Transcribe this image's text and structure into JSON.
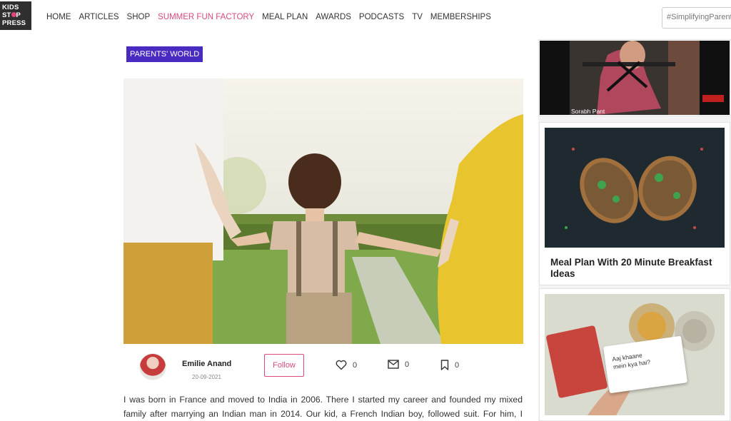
{
  "logo": {
    "line1": "KIDS",
    "line2a": "ST",
    "line2b": "P",
    "line3": "PRESS"
  },
  "nav": [
    "HOME",
    "ARTICLES",
    "SHOP",
    "SUMMER FUN FACTORY",
    "MEAL PLAN",
    "AWARDS",
    "PODCASTS",
    "TV",
    "MEMBERSHIPS"
  ],
  "nav_active_index": 3,
  "search": {
    "value": "#SimplifyingParenting"
  },
  "article": {
    "category": "PARENTS' WORLD",
    "author": "Emilie Anand",
    "date": "20-09-2021",
    "follow_label": "Follow",
    "likes": "0",
    "comments": "0",
    "bookmarks": "0",
    "body": "I was born in France and moved to India in 2006. There I started my career and founded my mixed family after marrying an Indian man in 2014. Our kid, a French Indian boy, followed suit. For him, I wrote"
  },
  "sidebar": {
    "video_person": "Sorabh Pant",
    "meal_title": "Meal Plan With 20 Minute Breakfast Ideas",
    "card_note_line1": "Aaj khaane",
    "card_note_line2": "mein kya hai?"
  },
  "colors": {
    "accent": "#d84a7e",
    "category_bg": "#4a2bc2"
  }
}
